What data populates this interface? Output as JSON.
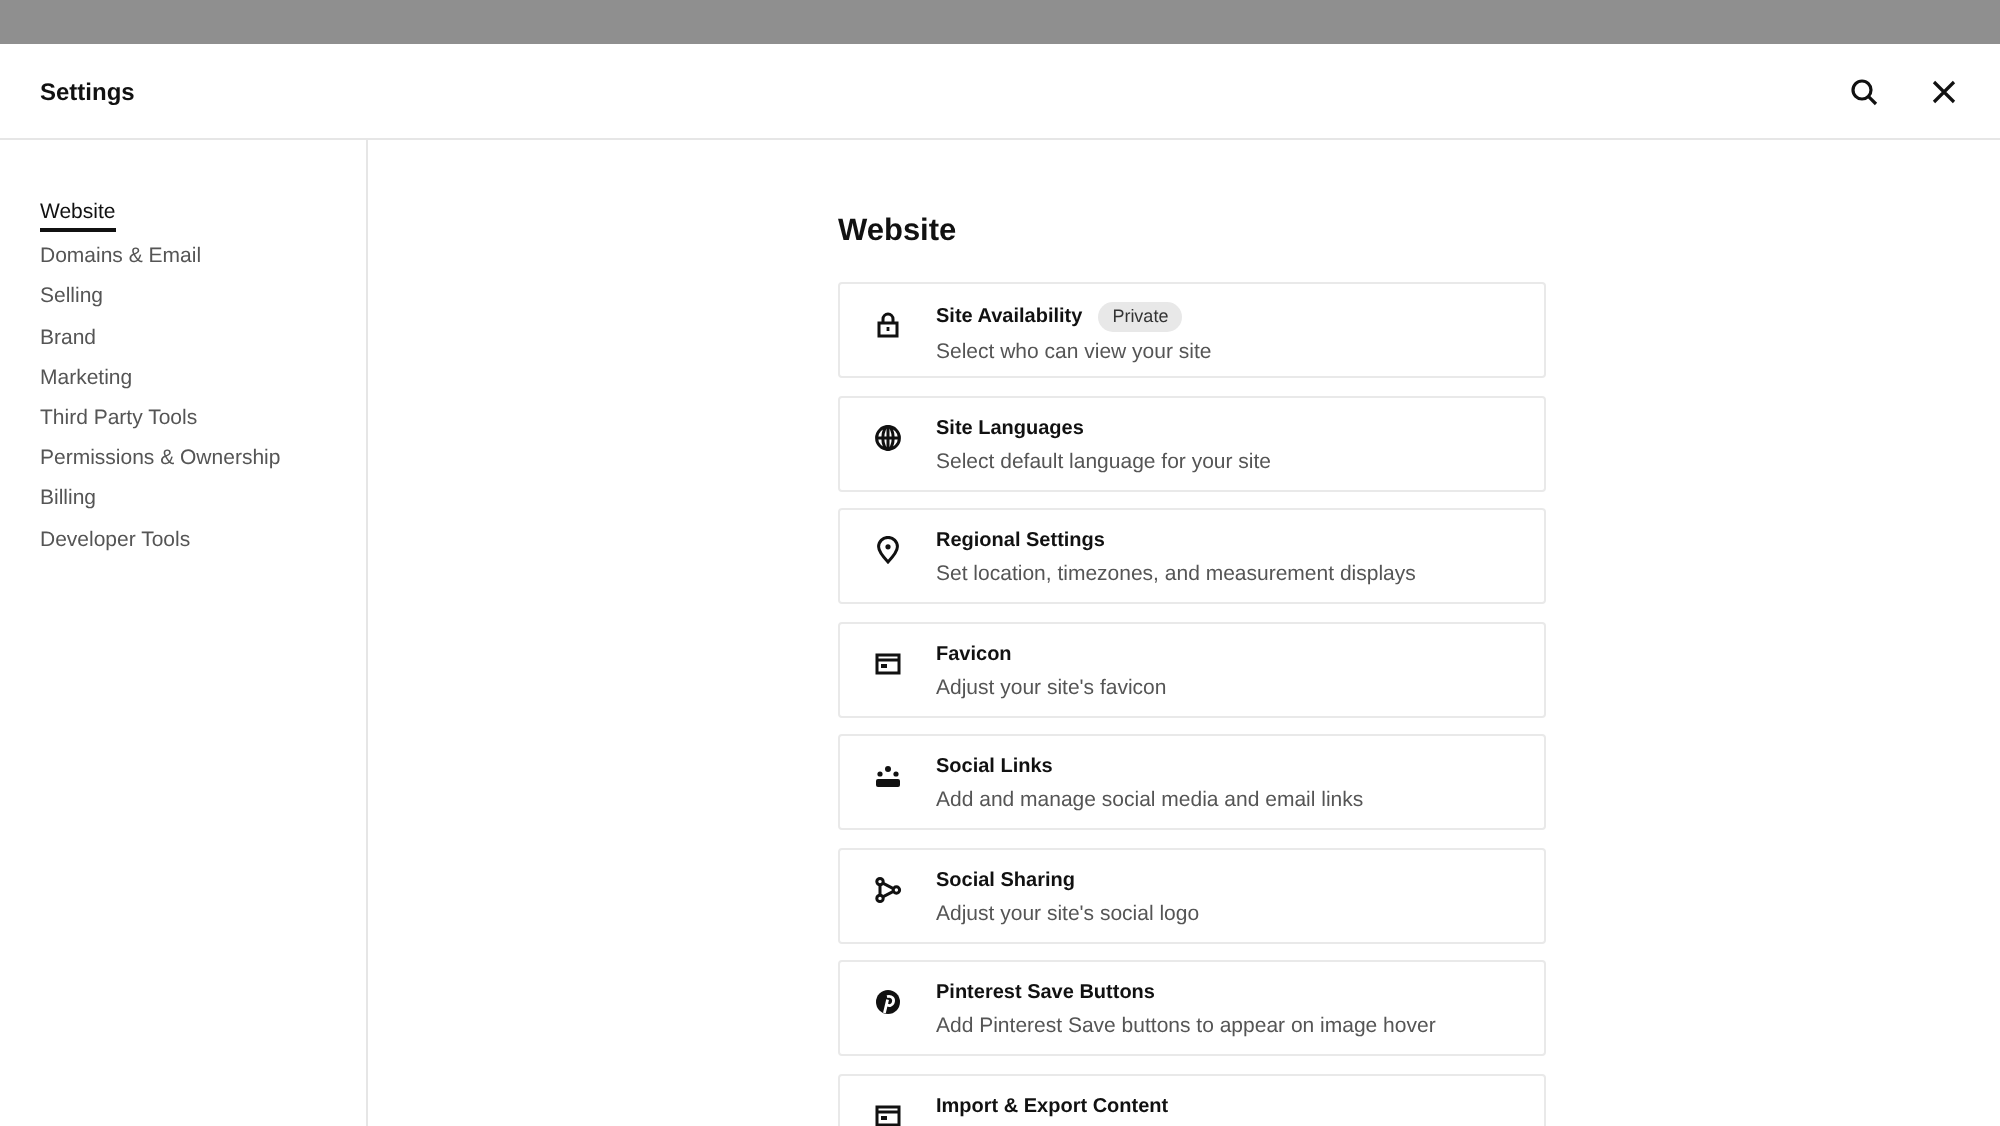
{
  "header": {
    "title": "Settings"
  },
  "sidebar": {
    "items": [
      {
        "label": "Website",
        "selected": true
      },
      {
        "label": "Domains & Email",
        "selected": false
      },
      {
        "label": "Selling",
        "selected": false
      },
      {
        "label": "Brand",
        "selected": false
      },
      {
        "label": "Marketing",
        "selected": false
      },
      {
        "label": "Third Party Tools",
        "selected": false
      },
      {
        "label": "Permissions & Ownership",
        "selected": false
      },
      {
        "label": "Billing",
        "selected": false
      },
      {
        "label": "Developer Tools",
        "selected": false
      }
    ]
  },
  "content": {
    "heading": "Website",
    "items": [
      {
        "kind": "lock",
        "title": "Site Availability",
        "badge": "Private",
        "description": "Select who can view your site"
      },
      {
        "kind": "globe",
        "title": "Site Languages",
        "description": "Select default language for your site"
      },
      {
        "kind": "pin",
        "title": "Regional Settings",
        "description": "Set location, timezones, and measurement displays"
      },
      {
        "kind": "window",
        "title": "Favicon",
        "description": "Adjust your site's favicon"
      },
      {
        "kind": "people",
        "title": "Social Links",
        "description": "Add and manage social media and email links"
      },
      {
        "kind": "share",
        "title": "Social Sharing",
        "description": "Adjust your site's social logo"
      },
      {
        "kind": "pinterest",
        "title": "Pinterest Save Buttons",
        "description": "Add Pinterest Save buttons to appear on image hover"
      },
      {
        "kind": "window",
        "title": "Import & Export Content"
      }
    ]
  }
}
